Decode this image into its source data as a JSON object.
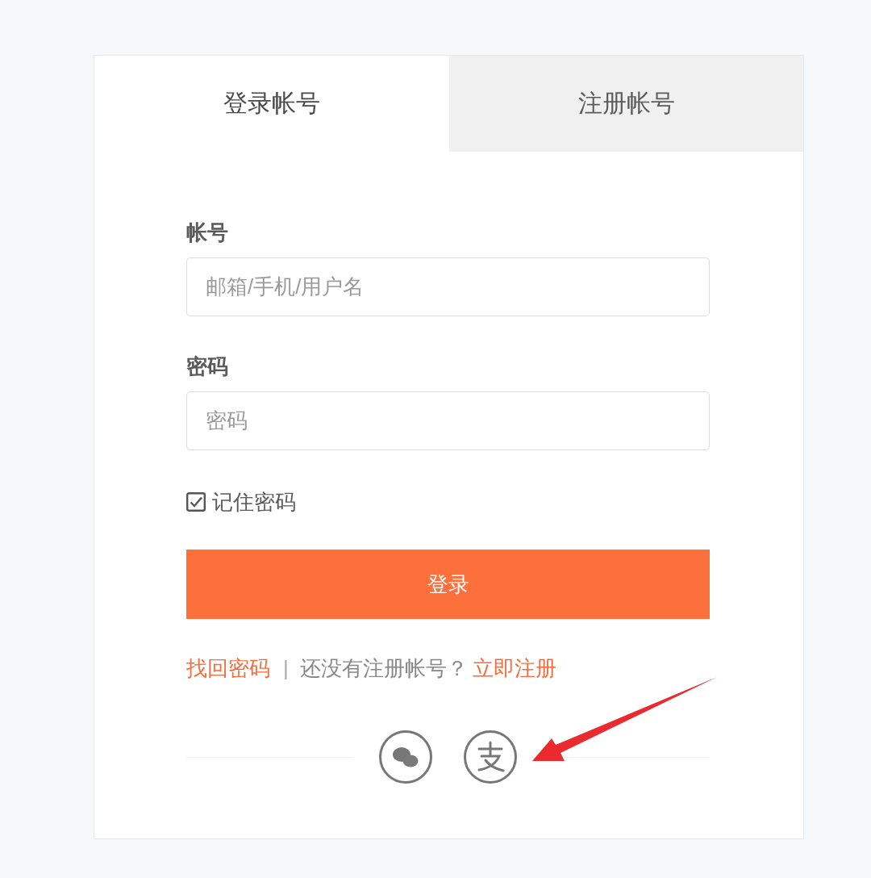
{
  "tabs": [
    {
      "label": "登录帐号",
      "selected": true
    },
    {
      "label": "注册帐号",
      "selected": false
    }
  ],
  "form": {
    "fields": [
      {
        "label": "帐号",
        "placeholder": "邮箱/手机/用户名"
      },
      {
        "label": "密码",
        "placeholder": "密码"
      }
    ],
    "remember": {
      "label": "记住密码",
      "checked": true
    },
    "submit": "登录",
    "links": [
      {
        "kind": "link",
        "text": "找回密码"
      },
      {
        "kind": "separator",
        "text": "|"
      },
      {
        "kind": "text",
        "text": "还没有注册帐号？"
      },
      {
        "kind": "link",
        "text": "立即注册"
      }
    ]
  },
  "social_login": [
    {
      "kind": "chat"
    },
    {
      "kind": "pay"
    }
  ]
}
